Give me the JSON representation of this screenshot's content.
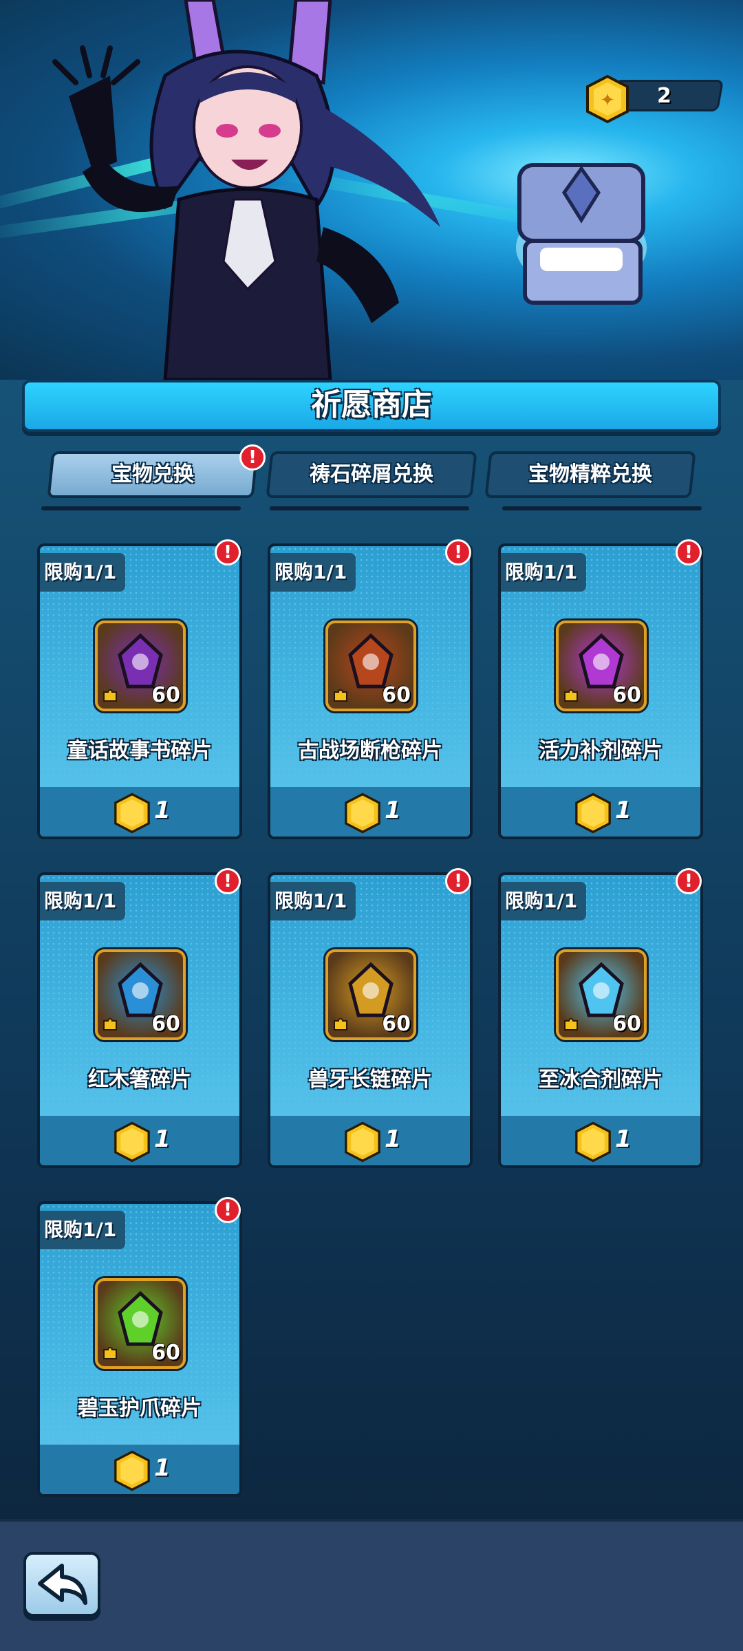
{
  "header": {
    "currency_amount": "2",
    "currency_icon": "gold-coin-icon",
    "chest_icon": "treasure-chest-icon"
  },
  "shop": {
    "title": "祈愿商店"
  },
  "tabs": [
    {
      "label": "宝物兑换",
      "active": true,
      "badge": "!"
    },
    {
      "label": "祷石碎屑兑换",
      "active": false
    },
    {
      "label": "宝物精粹兑换",
      "active": false
    }
  ],
  "items": [
    {
      "limit": "限购1/1",
      "name": "童话故事书碎片",
      "qty": "60",
      "price": "1",
      "badge": "!",
      "icon": "storybook-icon",
      "color": "#7a2fb3"
    },
    {
      "limit": "限购1/1",
      "name": "古战场断枪碎片",
      "qty": "60",
      "price": "1",
      "badge": "!",
      "icon": "broken-spear-icon",
      "color": "#b6461c"
    },
    {
      "limit": "限购1/1",
      "name": "活力补剂碎片",
      "qty": "60",
      "price": "1",
      "badge": "!",
      "icon": "potion-icon",
      "color": "#b039d2"
    },
    {
      "limit": "限购1/1",
      "name": "红木箸碎片",
      "qty": "60",
      "price": "1",
      "badge": "!",
      "icon": "chopsticks-icon",
      "color": "#2a8fd6"
    },
    {
      "limit": "限购1/1",
      "name": "兽牙长链碎片",
      "qty": "60",
      "price": "1",
      "badge": "!",
      "icon": "fang-chain-icon",
      "color": "#d49b22"
    },
    {
      "limit": "限购1/1",
      "name": "至冰合剂碎片",
      "qty": "60",
      "price": "1",
      "badge": "!",
      "icon": "ice-crystal-icon",
      "color": "#4fc4f0"
    },
    {
      "limit": "限购1/1",
      "name": "碧玉护爪碎片",
      "qty": "60",
      "price": "1",
      "badge": "!",
      "icon": "jade-claw-icon",
      "color": "#5fcf2a"
    }
  ],
  "footer": {
    "back_icon": "back-arrow-icon"
  }
}
